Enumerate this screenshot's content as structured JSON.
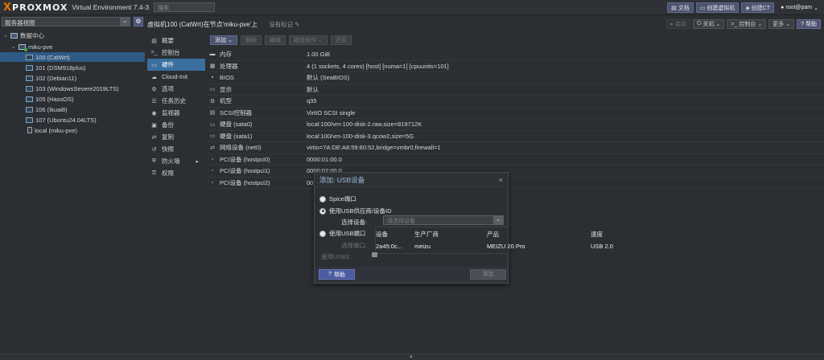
{
  "topbar": {
    "logo_word": "PROXMOX",
    "version": "Virtual Environment 7.4-3",
    "search_placeholder": "搜索",
    "docs": "文档",
    "create_vm": "创建虚拟机",
    "create_ct": "创建CT",
    "user": "root@pam"
  },
  "sidebar": {
    "view": "服务器视图",
    "datacenter": "数据中心",
    "node": "miku-pve",
    "items": [
      "100 (CatWrt)",
      "101 (DSM918plus)",
      "102 (Debian11)",
      "103 (WindowsSevere2019LTS)",
      "105 (HassOS)",
      "106 (Ikuai8)",
      "107 (Ubuntu24.04LTS)",
      "local (miku-pve)"
    ]
  },
  "header": {
    "title": "虚拟机100 (CatWrt)在节点'miku-pve'上",
    "tag": "没有标记",
    "start": "启动",
    "shutdown": "关机",
    "console": "控制台",
    "more": "更多",
    "help": "帮助"
  },
  "subnav": [
    "概要",
    "控制台",
    "硬件",
    "Cloud-Init",
    "选项",
    "任务历史",
    "监视器",
    "备份",
    "复制",
    "快照",
    "防火墙",
    "权限"
  ],
  "toolbar": {
    "add": "添加",
    "remove": "删除",
    "edit": "编辑",
    "disk_action": "磁盘操作",
    "revert": "还原"
  },
  "hardware": [
    {
      "key": "内存",
      "value": "1.00 GiB"
    },
    {
      "key": "处理器",
      "value": "4 (1 sockets, 4 cores) [host] [numa=1] [cpuunits=101]"
    },
    {
      "key": "BIOS",
      "value": "默认 (SeaBIOS)"
    },
    {
      "key": "显示",
      "value": "默认"
    },
    {
      "key": "机型",
      "value": "q35"
    },
    {
      "key": "SCSI控制器",
      "value": "VirtIO SCSI single"
    },
    {
      "key": "硬盘 (sata0)",
      "value": "local:100/vm-100-disk-2.raw,size=819712K"
    },
    {
      "key": "硬盘 (sata1)",
      "value": "local:100/vm-100-disk-3.qcow2,size=5G"
    },
    {
      "key": "网络设备 (net0)",
      "value": "virtio=7A:DE:A8:59:60:52,bridge=vmbr0,firewall=1"
    },
    {
      "key": "PCI设备 (hostpci0)",
      "value": "0000:01:00.0"
    },
    {
      "key": "PCI设备 (hostpci1)",
      "value": "0000:02:00.0"
    },
    {
      "key": "PCI设备 (hostpci2)",
      "value": "00"
    }
  ],
  "dialog": {
    "title": "添加: USB设备",
    "opt_spice": "Spice端口",
    "opt_vendor": "使用USB供应商/设备ID",
    "choose_device": "选择设备:",
    "device_placeholder": "请选择设备",
    "opt_port": "使用USB端口",
    "choose_port": "选择端口:",
    "use_usb3": "使用USB3:",
    "help": "帮助",
    "add": "添加",
    "table_header": [
      "设备",
      "生产厂商",
      "产品",
      "速度"
    ],
    "table_row": [
      "2a45:0c...",
      "meizu",
      "MEIZU 20 Pro",
      "USB 2.0"
    ]
  }
}
